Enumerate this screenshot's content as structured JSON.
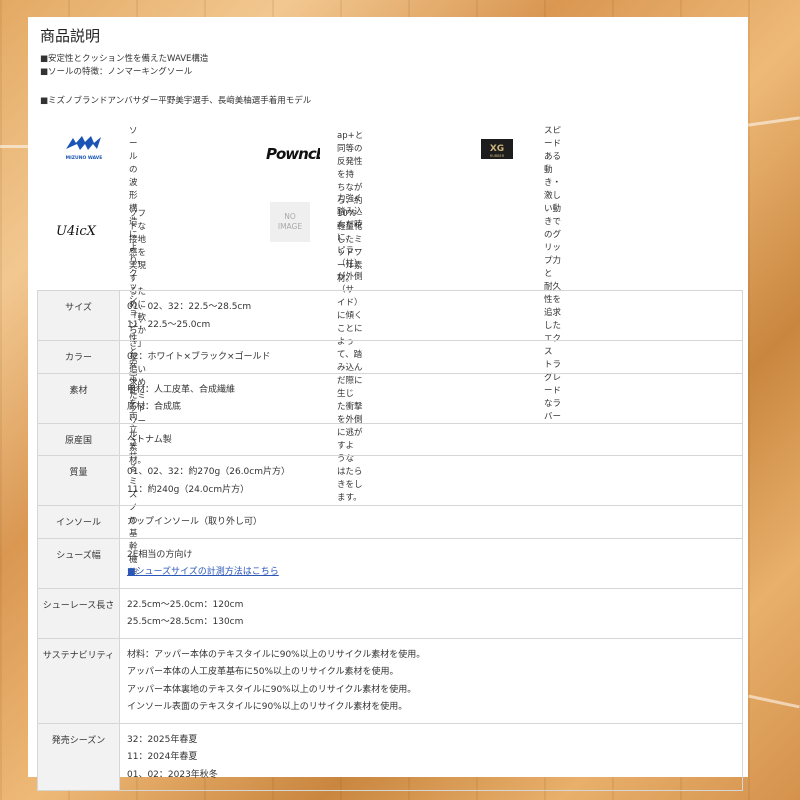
{
  "section_title": "商品説明",
  "features": [
    "■安定性とクッション性を備えたWAVE構造",
    "■ソールの特徴：ノンマーキングソール"
  ],
  "ambassador_note": "■ミズノブランドアンバサダー平野美宇選手、長﨑美柚選手着用モデル",
  "technologies": [
    {
      "logo_icon": "mizuno-wave-logo",
      "logo_text": "MIZUNO WAVE",
      "description": "ソールの波形構造によ\nり、クッション性と安定\n性を両立させるミズノの\n基幹機能"
    },
    {
      "logo_icon": "pownce-logo",
      "logo_text": "PowncE",
      "description": "ap+と同等の反発性を持\nちながら、約10%軽量化\nしたミッドソール素材。"
    },
    {
      "logo_icon": "xg-rubber-logo",
      "logo_text": "XG",
      "logo_subtext": "RUBBER",
      "description": "スピードある動き・激し\nい動きでのグリップ力と\n耐久性を追求したエクス\nトラグレードなラバー"
    },
    {
      "logo_icon": "u4icx-logo",
      "logo_text": "U4icX",
      "description": "ソフトな接地感を実現す\nるために「軟らかさ」を\n追い求めたミッドソール\n素材。"
    },
    {
      "logo_icon": "no-image-placeholder",
      "logo_text": "NO\nIMAGE",
      "description": "力強く踏み込んだ時に、\nピラー（柱）が外側（サ\nイド）に傾くことによっ\nて、踏み込んだ際に生じ\nた衝撃を外側に逃がすよ\nうなはたらきをします。"
    }
  ],
  "specs": [
    {
      "label": "サイズ",
      "lines": [
        "01、02、32：22.5〜28.5cm",
        "11：22.5〜25.0cm"
      ]
    },
    {
      "label": "カラー",
      "lines": [
        "02：ホワイト×ブラック×ゴールド"
      ]
    },
    {
      "label": "素材",
      "lines": [
        "甲材：人工皮革、合成繊維",
        "底材：合成底"
      ]
    },
    {
      "label": "原産国",
      "lines": [
        "ベトナム製"
      ]
    },
    {
      "label": "質量",
      "lines": [
        "01、02、32：約270g（26.0cm片方）",
        "11：約240g（24.0cm片方）"
      ]
    },
    {
      "label": "インソール",
      "lines": [
        "カップインソール（取り外し可）"
      ]
    },
    {
      "label": "シューズ幅",
      "lines": [
        "2E相当の方向け"
      ],
      "link": "■シューズサイズの計測方法はこちら"
    },
    {
      "label": "シューレース長さ",
      "lines": [
        "22.5cm〜25.0cm：120cm",
        "25.5cm〜28.5cm：130cm"
      ]
    },
    {
      "label": "サステナビリティ",
      "lines": [
        "材料：アッパー本体のテキスタイルに90%以上のリサイクル素材を使用。",
        "アッパー本体の人工皮革基布に50%以上のリサイクル素材を使用。",
        "アッパー本体裏地のテキスタイルに90%以上のリサイクル素材を使用。",
        "インソール表面のテキスタイルに90%以上のリサイクル素材を使用。"
      ]
    },
    {
      "label": "発売シーズン",
      "lines": [
        "32：2025年春夏",
        "11：2024年春夏",
        "01、02：2023年秋冬"
      ]
    }
  ],
  "colors": {
    "link": "#2a56b8",
    "mizuno_blue": "#1a55b5",
    "header_bg": "#f2f2f2",
    "border": "#d6d6d6"
  }
}
